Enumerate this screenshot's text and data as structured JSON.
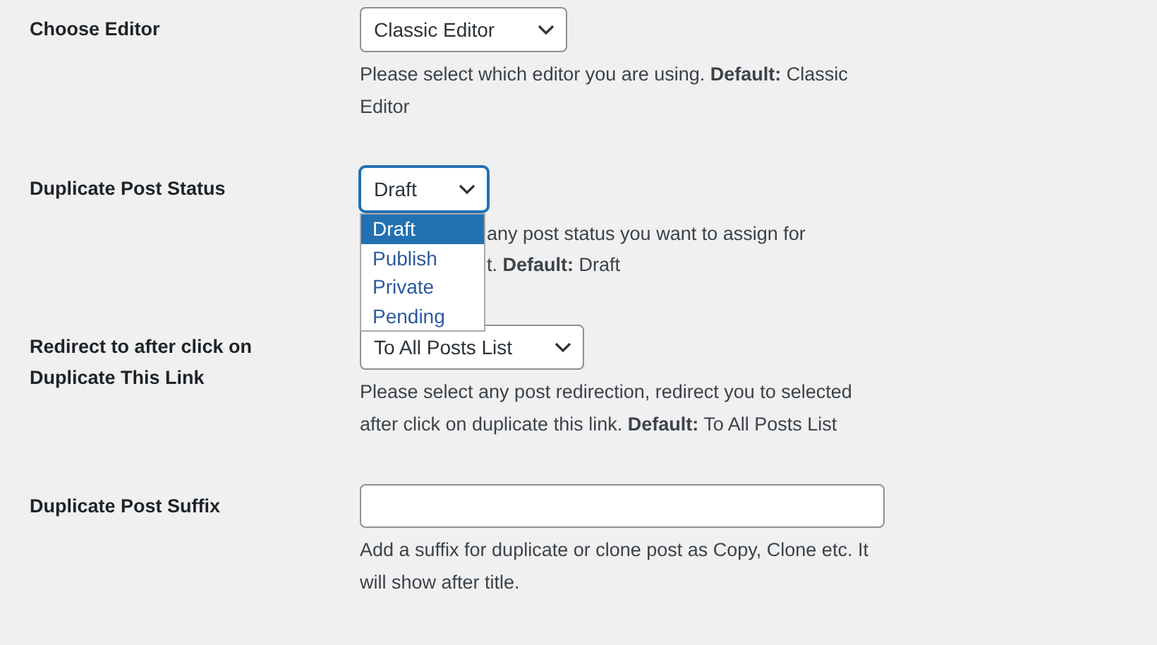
{
  "settings": [
    {
      "label": "Choose Editor",
      "control": {
        "kind": "select",
        "value": "Classic Editor",
        "open": false
      },
      "description": "Please select which editor you are using. **Default:** Classic Editor"
    },
    {
      "label": "Duplicate Post Status",
      "control": {
        "kind": "select",
        "value": "Draft",
        "open": true,
        "options": [
          {
            "label": "Draft",
            "selected": true
          },
          {
            "label": "Publish",
            "selected": false
          },
          {
            "label": "Private",
            "selected": false
          },
          {
            "label": "Pending",
            "selected": false
          }
        ]
      },
      "description_lines": [
        "any post status you want to assign for",
        "t. **Default:** Draft"
      ]
    },
    {
      "label": "Redirect to after click on Duplicate This Link",
      "control": {
        "kind": "select",
        "value": "To All Posts List",
        "open": false
      },
      "description": "Please select any post redirection, redirect you to selected after click on duplicate this link. **Default:** To All Posts List"
    },
    {
      "label": "Duplicate Post Suffix",
      "control": {
        "kind": "text"
      },
      "description": "Add a suffix for duplicate or clone post as Copy, Clone etc. It will show after title."
    }
  ]
}
